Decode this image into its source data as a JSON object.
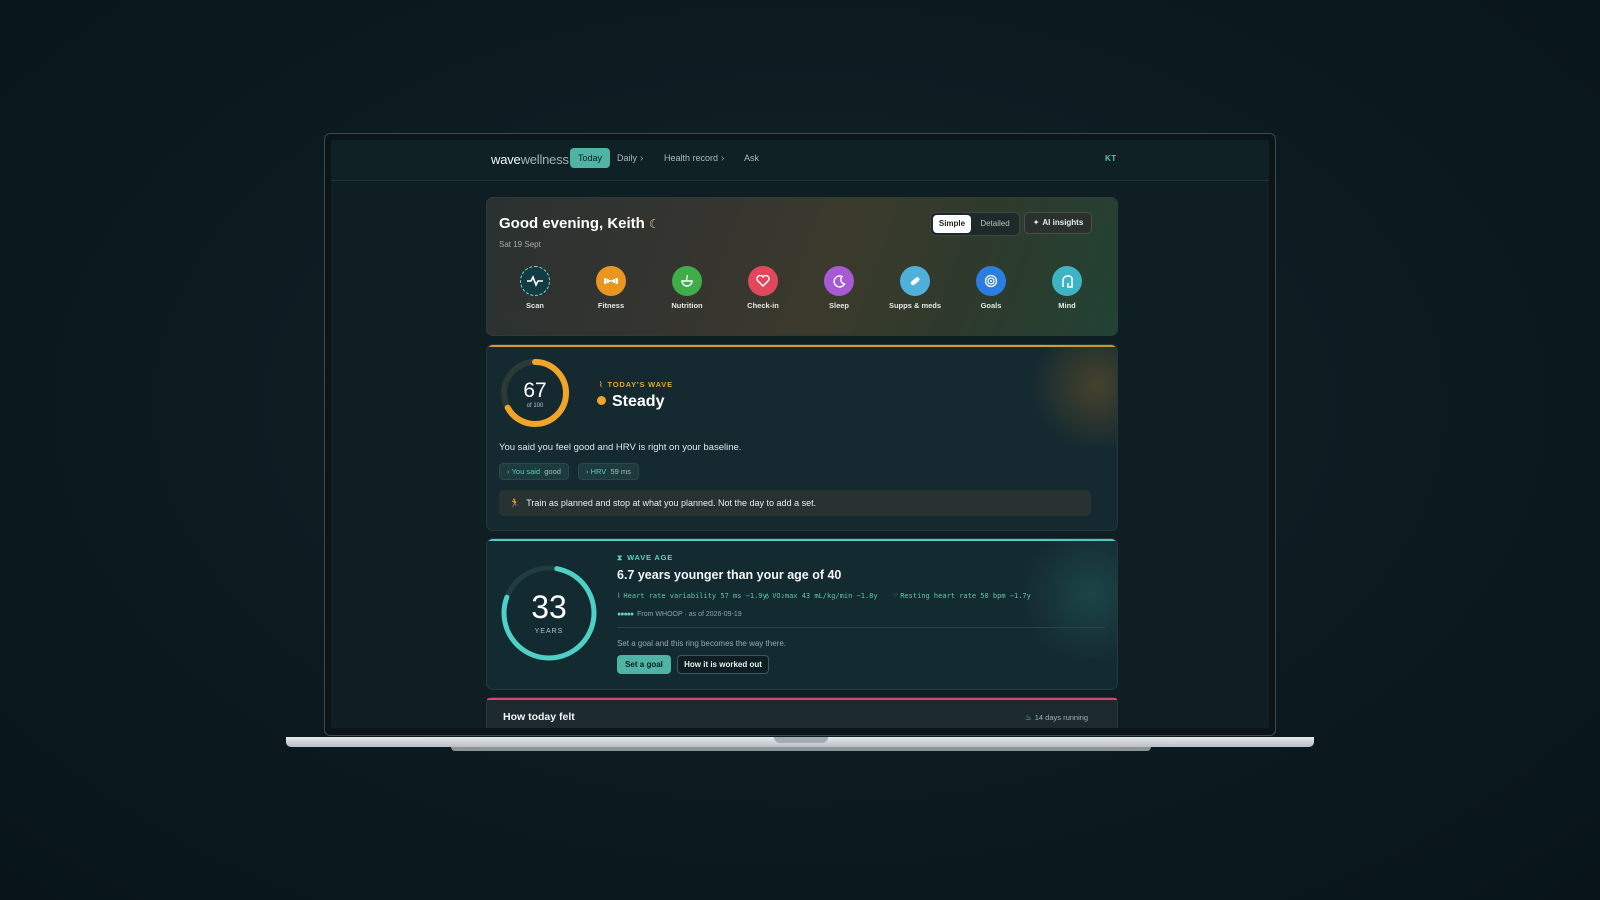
{
  "app": {
    "logo_a": "wave",
    "logo_b": "wellness",
    "user_initials": "KT"
  },
  "nav": {
    "tabs": [
      {
        "label": "Today",
        "active": true
      },
      {
        "label": "Daily",
        "chevron": true
      },
      {
        "label": "Health record",
        "chevron": true
      },
      {
        "label": "Ask"
      }
    ]
  },
  "hero": {
    "greeting": "Good evening, Keith",
    "date": "Sat 19 Sept",
    "view_simple": "Simple",
    "view_detailed": "Detailed",
    "ai_insights": "AI insights",
    "actions": [
      {
        "label": "Scan",
        "icon": "pulse-icon",
        "color": "#123b44"
      },
      {
        "label": "Fitness",
        "icon": "dumbbell-icon",
        "color": "#e89620"
      },
      {
        "label": "Nutrition",
        "icon": "bowl-icon",
        "color": "#3fae4a"
      },
      {
        "label": "Check-in",
        "icon": "heart-icon",
        "color": "#e0485c"
      },
      {
        "label": "Sleep",
        "icon": "moon-icon",
        "color": "#a65bd3"
      },
      {
        "label": "Supps & meds",
        "icon": "pill-icon",
        "color": "#4fb0d9"
      },
      {
        "label": "Goals",
        "icon": "target-icon",
        "color": "#2c7de0"
      },
      {
        "label": "Mind",
        "icon": "mind-icon",
        "color": "#3fb3c3"
      }
    ]
  },
  "todays_wave": {
    "score": "67",
    "score_of": "of 100",
    "score_fraction": 0.67,
    "label": "TODAY'S WAVE",
    "state": "Steady",
    "description": "You said you feel good and HRV is right on your baseline.",
    "chips": [
      {
        "key": "You said",
        "value": "good"
      },
      {
        "key": "HRV",
        "value": "59 ms"
      }
    ],
    "advice": "Train as planned and stop at what you planned. Not the day to add a set.",
    "accent": "#f0a52a"
  },
  "wave_age": {
    "value": "33",
    "unit": "YEARS",
    "label": "WAVE AGE",
    "title": "6.7 years younger than your age of 40",
    "metrics": [
      "Heart rate variability 57 ms −1.9y",
      "VO₂max 43 mL/kg/min −1.8y",
      "Resting heart rate 50 bpm −1.7y"
    ],
    "source": "From WHOOP · as of 2026-09-19",
    "goal_text": "Set a goal and this ring becomes the way there.",
    "btn_goal": "Set a goal",
    "btn_how": "How it is worked out",
    "accent": "#4fd0c6"
  },
  "how_today_felt": {
    "title": "How today felt",
    "streak": "14 days running"
  }
}
